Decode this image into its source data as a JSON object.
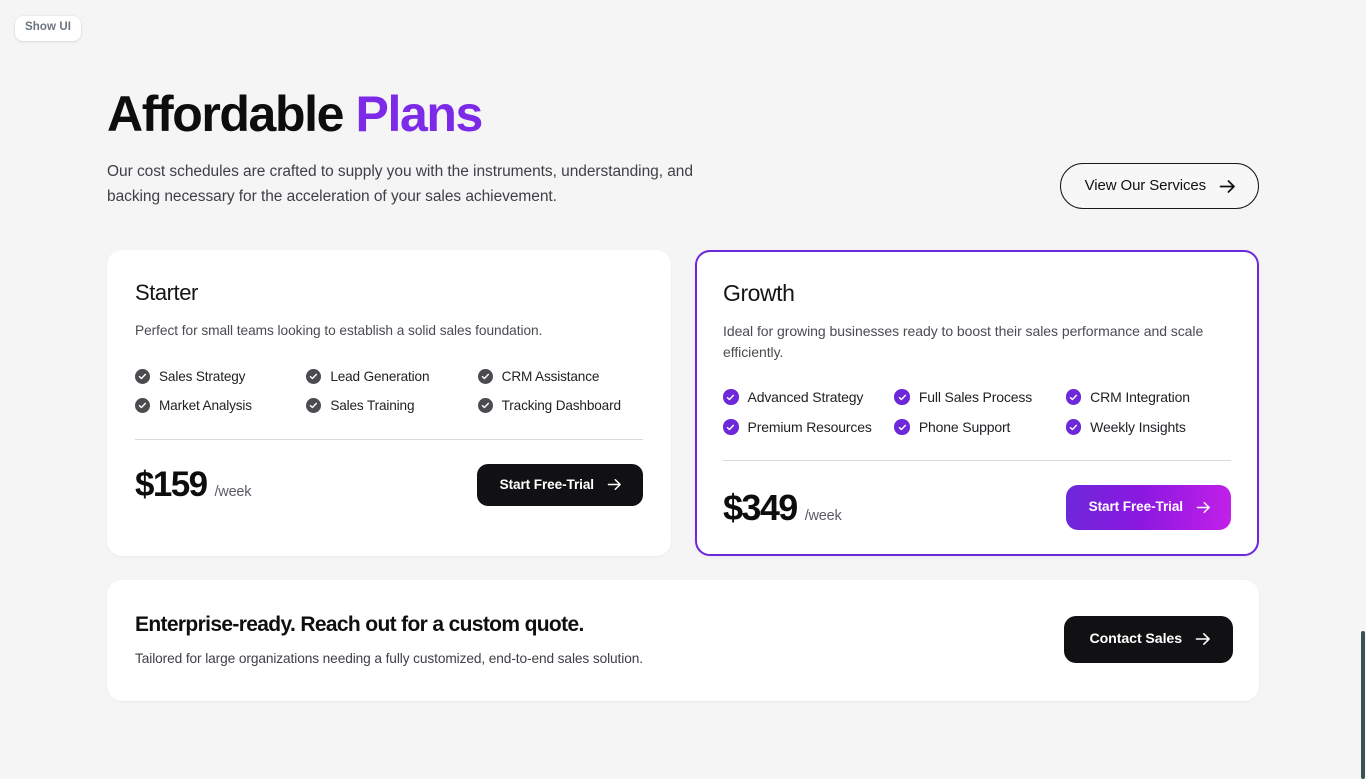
{
  "chip": {
    "label": "Show UI"
  },
  "header": {
    "title_main": "Affordable ",
    "title_accent": "Plans",
    "subtitle": "Our cost schedules are crafted to supply you with the instruments, understanding, and backing necessary for the acceleration of your sales achievement.",
    "services_button": "View Our Services",
    "services_icon": "arrow-right-icon"
  },
  "plans": [
    {
      "name": "Starter",
      "description": "Perfect for small teams looking to establish a solid sales foundation.",
      "features": [
        "Sales Strategy",
        "Lead Generation",
        "CRM Assistance",
        "Market Analysis",
        "Sales Training",
        "Tracking Dashboard"
      ],
      "check_icon": "check-circle-icon",
      "check_color": "#4b4b50",
      "price": "$159",
      "period": "/week",
      "cta_label": "Start Free-Trial",
      "cta_icon": "arrow-right-icon",
      "highlighted": false
    },
    {
      "name": "Growth",
      "description": "Ideal for growing businesses ready to boost their sales performance and scale efficiently.",
      "features": [
        "Advanced Strategy",
        "Full Sales Process",
        "CRM Integration",
        "Premium Resources",
        "Phone Support",
        "Weekly Insights"
      ],
      "check_icon": "check-circle-icon",
      "check_color": "#6d28d9",
      "price": "$349",
      "period": "/week",
      "cta_label": "Start Free-Trial",
      "cta_icon": "arrow-right-icon",
      "highlighted": true
    }
  ],
  "enterprise": {
    "title": "Enterprise-ready. Reach out for a custom quote.",
    "subtitle": "Tailored for large organizations needing a fully customized, end-to-end sales solution.",
    "cta_label": "Contact Sales",
    "cta_icon": "arrow-right-icon"
  },
  "colors": {
    "accent_purple": "#7c2ae8",
    "border_purple": "#6d28d9",
    "gradient_end": "#c320e8",
    "dark": "#111113",
    "page_bg": "#f5f5f5"
  }
}
